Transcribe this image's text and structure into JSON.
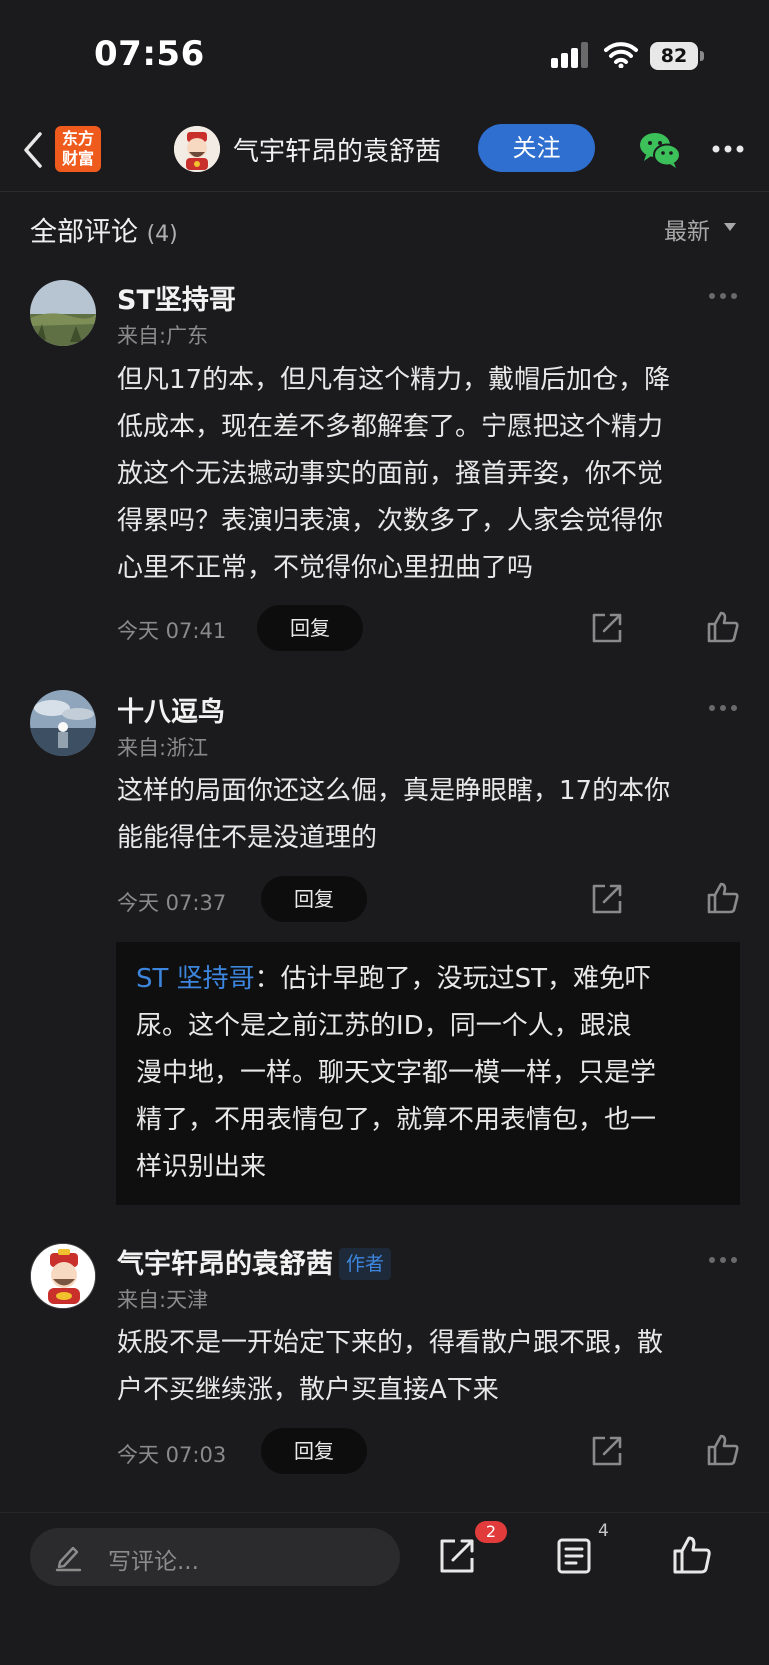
{
  "status_bar": {
    "time": "07:56",
    "battery": "82"
  },
  "nav": {
    "logo_line1": "东方",
    "logo_line2": "财富",
    "author_name": "气宇轩昂的袁舒茜",
    "follow_label": "关注"
  },
  "section": {
    "title": "全部评论",
    "count": "(4)",
    "sort_label": "最新"
  },
  "comments": [
    {
      "user": "ST坚持哥",
      "location": "来自:广东",
      "lines": [
        "但凡17的本，但凡有这个精力，戴帽后加仓，降",
        "低成本，现在差不多都解套了。宁愿把这个精力",
        "放这个无法撼动事实的面前，搔首弄姿，你不觉",
        "得累吗？表演归表演，次数多了，人家会觉得你",
        "心里不正常，不觉得你心里扭曲了吗"
      ],
      "time": "今天 07:41",
      "reply_label": "回复"
    },
    {
      "user": "十八逗鸟",
      "location": "来自:浙江",
      "lines": [
        "这样的局面你还这么倔，真是睁眼瞎，17的本你",
        "能能得住不是没道理的"
      ],
      "time": "今天 07:37",
      "reply_label": "回复",
      "sub_reply": {
        "user": "ST 坚持哥",
        "sep": "：",
        "first": "估计早跑了，没玩过ST，难免吓",
        "lines": [
          "尿。这个是之前江苏的ID，同一个人，跟浪",
          "漫中地，一样。聊天文字都一模一样，只是学",
          "精了，不用表情包了，就算不用表情包，也一",
          "样识别出来"
        ]
      }
    },
    {
      "user": "气宇轩昂的袁舒茜",
      "tag": "作者",
      "location": "来自:天津",
      "lines": [
        "妖股不是一开始定下来的，得看散户跟不跟，散",
        "户不买继续涨，散户买直接A下来"
      ],
      "time": "今天 07:03",
      "reply_label": "回复"
    }
  ],
  "bottom_bar": {
    "placeholder": "写评论...",
    "share_badge": "2",
    "comment_count": "4"
  }
}
